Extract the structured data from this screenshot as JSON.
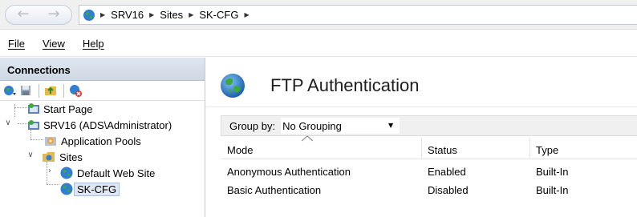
{
  "address_bar": {
    "back_icon": "back-arrow-icon",
    "forward_icon": "forward-arrow-icon",
    "crumbs": [
      "SRV16",
      "Sites",
      "SK-CFG"
    ]
  },
  "menu": {
    "file": "File",
    "view": "View",
    "help": "Help"
  },
  "connections": {
    "header": "Connections",
    "tree": {
      "start_page": "Start Page",
      "server": "SRV16 (ADS\\Administrator)",
      "app_pools": "Application Pools",
      "sites": "Sites",
      "default_site": "Default Web Site",
      "selected_site": "SK-CFG"
    }
  },
  "feature": {
    "title": "FTP Authentication",
    "group_by_label": "Group by:",
    "group_by_value": "No Grouping",
    "columns": [
      "Mode",
      "Status",
      "Type"
    ],
    "rows": [
      {
        "mode": "Anonymous Authentication",
        "status": "Enabled",
        "type": "Built-In"
      },
      {
        "mode": "Basic Authentication",
        "status": "Disabled",
        "type": "Built-In"
      }
    ]
  },
  "colors": {
    "header_gradient_top": "#dfe6ef",
    "selection": "#dfe7f2",
    "toolbar_bg": "#f0f0f0"
  }
}
